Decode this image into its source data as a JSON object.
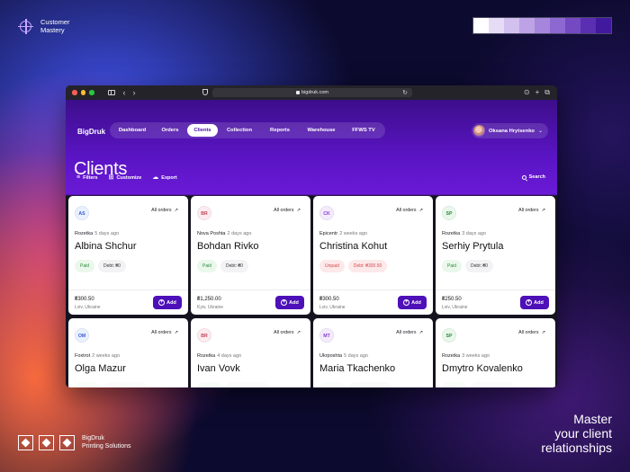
{
  "brand": {
    "title_line1": "Customer",
    "title_line2": "Mastery"
  },
  "palette": [
    "#ffffff",
    "#e6dcf6",
    "#d2c0ef",
    "#bda3e6",
    "#a686dc",
    "#8e68d1",
    "#7549c2",
    "#5a2fb1",
    "#41199f"
  ],
  "browser": {
    "url": "bigdruk.com",
    "lock_icon": "lock-icon",
    "reload_icon": "reload-icon"
  },
  "app": {
    "logo": "BigDruk",
    "nav": [
      {
        "label": "Dashboard",
        "active": false
      },
      {
        "label": "Orders",
        "active": false
      },
      {
        "label": "Clients",
        "active": true
      },
      {
        "label": "Collection",
        "active": false
      },
      {
        "label": "Reports",
        "active": false
      },
      {
        "label": "Warehouse",
        "active": false
      },
      {
        "label": "FFWS TV",
        "active": false
      }
    ],
    "user": {
      "name": "Oksana Hrytsenko"
    },
    "page_title": "Clients",
    "toolbar": {
      "filters": "Filters",
      "customize": "Customize",
      "export": "Export",
      "search": "Search"
    },
    "all_orders_label": "All orders",
    "add_label": "Add",
    "clients": [
      {
        "initials": "AS",
        "color": "#eaf1ff",
        "text_color": "#3b5bd6",
        "source": "Rozetka",
        "ago": "5 days ago",
        "name": "Albina Shchur",
        "status": "Paid",
        "debt": "Debt: ₴0",
        "amount": "₴300.50",
        "location": "Lviv, Ukraine"
      },
      {
        "initials": "BR",
        "color": "#fdecef",
        "text_color": "#c0445c",
        "source": "Nova Poshta",
        "ago": "2 days ago",
        "name": "Bohdan Rivko",
        "status": "Paid",
        "debt": "Debt: ₴0",
        "amount": "₴1,250.00",
        "location": "Kyiv, Ukraine"
      },
      {
        "initials": "CK",
        "color": "#f4ebfd",
        "text_color": "#8a3fd0",
        "source": "Epicentr",
        "ago": "2 weeks ago",
        "name": "Christina Kohut",
        "status": "Unpaid",
        "debt": "Debt: ₴300.50",
        "amount": "₴300.50",
        "location": "Lviv, Ukraine"
      },
      {
        "initials": "SP",
        "color": "#eaf8ec",
        "text_color": "#2d8a3a",
        "source": "Rozetka",
        "ago": "3 days ago",
        "name": "Serhiy Prytula",
        "status": "Paid",
        "debt": "Debt: ₴0",
        "amount": "₴250.50",
        "location": "Lviv, Ukraine"
      },
      {
        "initials": "OM",
        "color": "#eaf1ff",
        "text_color": "#3b5bd6",
        "source": "Foxtrot",
        "ago": "2 weeks ago",
        "name": "Olga Mazur"
      },
      {
        "initials": "BR",
        "color": "#fdecef",
        "text_color": "#c0445c",
        "source": "Rozetka",
        "ago": "4 days ago",
        "name": "Ivan Vovk"
      },
      {
        "initials": "MT",
        "color": "#f4ebfd",
        "text_color": "#8a3fd0",
        "source": "Ukrposhta",
        "ago": "5 days ago",
        "name": "Maria Tkachenko"
      },
      {
        "initials": "SP",
        "color": "#eaf8ec",
        "text_color": "#2d8a3a",
        "source": "Rozetka",
        "ago": "3 weeks ago",
        "name": "Dmytro Kovalenko"
      }
    ]
  },
  "footer": {
    "brand_line1": "BigDruk",
    "brand_line2": "Printing Solutions"
  },
  "tagline": {
    "line1": "Master",
    "line2": "your client",
    "line3": "relationships"
  }
}
